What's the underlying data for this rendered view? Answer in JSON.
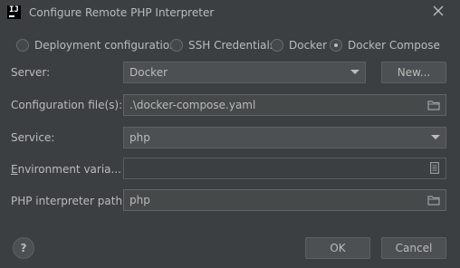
{
  "window": {
    "title": "Configure Remote PHP Interpreter"
  },
  "connection_types": {
    "options": [
      "Deployment configuration",
      "SSH Credentials",
      "Docker",
      "Docker Compose"
    ],
    "selected": "Docker Compose"
  },
  "form": {
    "server": {
      "label": "Server:",
      "value": "Docker",
      "button": "New..."
    },
    "config_files": {
      "label": "Configuration file(s):",
      "value": ".\\docker-compose.yaml"
    },
    "service": {
      "label": "Service:",
      "value": "php"
    },
    "env_vars": {
      "label": "Environment varia...",
      "value": ""
    },
    "php_path": {
      "label": "PHP interpreter path:",
      "value": "php"
    }
  },
  "footer": {
    "help": "?",
    "ok": "OK",
    "cancel": "Cancel"
  },
  "icons": [
    "app-logo-icon",
    "close-icon",
    "chevron-down-icon",
    "folder-icon",
    "document-icon"
  ]
}
